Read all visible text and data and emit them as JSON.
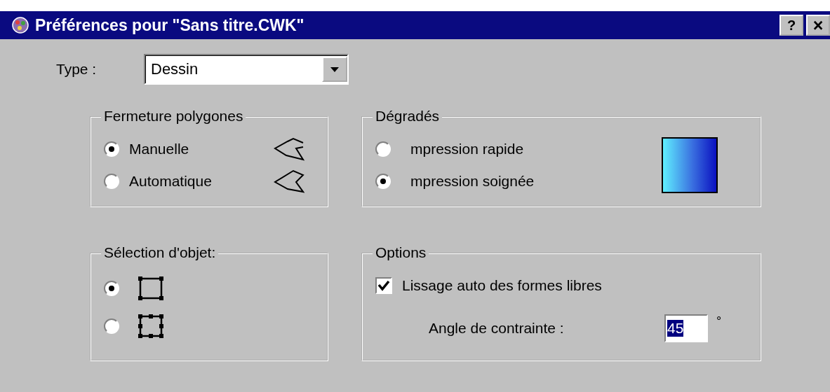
{
  "window": {
    "title": "Préférences pour \"Sans titre.CWK\"",
    "buttons": [
      {
        "kind": "help",
        "label": "?"
      },
      {
        "kind": "close",
        "label": "×"
      }
    ]
  },
  "type_field": {
    "label": "Type :",
    "value": "Dessin"
  },
  "polygon_closing": {
    "title": "Fermeture polygones",
    "options": [
      {
        "label": "Manuelle",
        "selected": true
      },
      {
        "label": "Automatique",
        "selected": false
      }
    ]
  },
  "gradients": {
    "title": "Dégradés",
    "options": [
      {
        "label": "mpression rapide",
        "selected": false
      },
      {
        "label": "mpression soignée",
        "selected": true
      }
    ]
  },
  "object_selection": {
    "title": "Sélection d'objet:",
    "options": [
      {
        "selected": true
      },
      {
        "selected": false
      }
    ]
  },
  "options": {
    "title": "Options",
    "smoothing": {
      "label": "Lissage auto des formes libres",
      "checked": true
    },
    "angle": {
      "label": "Angle de contrainte :",
      "value": "45",
      "unit": "°"
    }
  }
}
